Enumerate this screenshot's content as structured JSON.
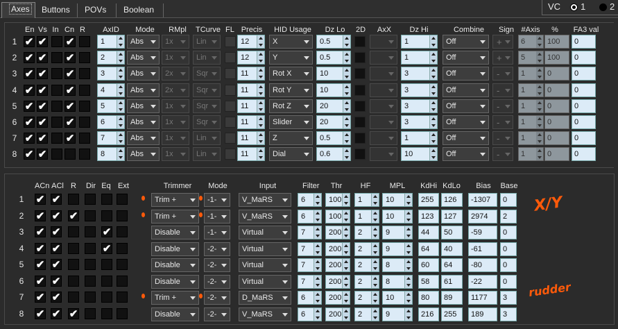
{
  "tabs": [
    {
      "label": "Axes",
      "active": true
    },
    {
      "label": "Buttons"
    },
    {
      "label": "POVs"
    },
    {
      "label": "Boolean"
    }
  ],
  "vc": {
    "label": "VC",
    "opt1": "1",
    "opt2": "2"
  },
  "axes_table": {
    "headers": {
      "en": "En",
      "vs": "Vs",
      "in": "In",
      "cn": "Cn",
      "r": "R",
      "axid": "AxID",
      "mode": "Mode",
      "rmpl": "RMpl",
      "tcurve": "TCurve",
      "fl": "FL",
      "precis": "Precis",
      "hid": "HID Usage",
      "dzlo": "Dz Lo",
      "twod": "2D",
      "axx": "AxX",
      "dzhi": "Dz Hi",
      "combine": "Combine",
      "sign": "Sign",
      "naxis": "#Axis",
      "pct": "%",
      "fa3": "FA3 val"
    },
    "rows": [
      {
        "num": "1",
        "en": true,
        "vs": true,
        "in": false,
        "cn": true,
        "r": false,
        "axid": "1",
        "mode": "Abs",
        "rmpl": "1x",
        "tcurve": "Lin",
        "precis": "12",
        "hid": "X",
        "dzlo": "0.5",
        "dzhi": "1",
        "combine": "Off",
        "sign": "+",
        "naxis": "6",
        "pct": "100",
        "fa3": "0"
      },
      {
        "num": "2",
        "en": true,
        "vs": true,
        "in": false,
        "cn": true,
        "r": false,
        "axid": "2",
        "mode": "Abs",
        "rmpl": "1x",
        "tcurve": "Lin",
        "precis": "12",
        "hid": "Y",
        "dzlo": "0.5",
        "dzhi": "1",
        "combine": "Off",
        "sign": "+",
        "naxis": "5",
        "pct": "100",
        "fa3": "0"
      },
      {
        "num": "3",
        "en": true,
        "vs": true,
        "in": false,
        "cn": true,
        "r": false,
        "axid": "3",
        "mode": "Abs",
        "rmpl": "2x",
        "tcurve": "Sqr",
        "precis": "11",
        "hid": "Rot X",
        "dzlo": "10",
        "dzhi": "3",
        "combine": "Off",
        "sign": "-",
        "naxis": "1",
        "pct": "0",
        "fa3": "0"
      },
      {
        "num": "4",
        "en": true,
        "vs": true,
        "in": false,
        "cn": true,
        "r": false,
        "axid": "4",
        "mode": "Abs",
        "rmpl": "2x",
        "tcurve": "Sqr",
        "precis": "11",
        "hid": "Rot Y",
        "dzlo": "10",
        "dzhi": "3",
        "combine": "Off",
        "sign": "-",
        "naxis": "1",
        "pct": "0",
        "fa3": "0"
      },
      {
        "num": "5",
        "en": true,
        "vs": true,
        "in": false,
        "cn": true,
        "r": false,
        "axid": "5",
        "mode": "Abs",
        "rmpl": "1x",
        "tcurve": "Sqr",
        "precis": "11",
        "hid": "Rot Z",
        "dzlo": "20",
        "dzhi": "3",
        "combine": "Off",
        "sign": "-",
        "naxis": "1",
        "pct": "0",
        "fa3": "0"
      },
      {
        "num": "6",
        "en": true,
        "vs": true,
        "in": false,
        "cn": true,
        "r": false,
        "axid": "6",
        "mode": "Abs",
        "rmpl": "1x",
        "tcurve": "Sqr",
        "precis": "11",
        "hid": "Slider",
        "dzlo": "20",
        "dzhi": "3",
        "combine": "Off",
        "sign": "-",
        "naxis": "1",
        "pct": "0",
        "fa3": "0"
      },
      {
        "num": "7",
        "en": true,
        "vs": true,
        "in": false,
        "cn": true,
        "r": false,
        "axid": "7",
        "mode": "Abs",
        "rmpl": "1x",
        "tcurve": "Lin",
        "precis": "11",
        "hid": "Z",
        "dzlo": "0.5",
        "dzhi": "1",
        "combine": "Off",
        "sign": "-",
        "naxis": "1",
        "pct": "0",
        "fa3": "0"
      },
      {
        "num": "8",
        "en": true,
        "vs": true,
        "in": false,
        "cn": false,
        "r": false,
        "axid": "8",
        "mode": "Abs",
        "rmpl": "1x",
        "tcurve": "Lin",
        "precis": "11",
        "hid": "Dial",
        "dzlo": "0.6",
        "dzhi": "10",
        "combine": "Off",
        "sign": "-",
        "naxis": "1",
        "pct": "0",
        "fa3": "0"
      }
    ]
  },
  "filter_table": {
    "headers": {
      "acn": "ACn",
      "acl": "ACl",
      "r": "R",
      "dir": "Dir",
      "eq": "Eq",
      "ext": "Ext",
      "trimmer": "Trimmer",
      "mode": "Mode",
      "input": "Input",
      "filter": "Filter",
      "thr": "Thr",
      "hf": "HF",
      "mpl": "MPL",
      "kdhi": "KdHi",
      "kdlo": "KdLo",
      "bias": "Bias",
      "base": "Base"
    },
    "rows": [
      {
        "num": "1",
        "acn": true,
        "acl": true,
        "r": false,
        "dir": false,
        "eq": false,
        "ext": false,
        "trimmer": "Trim +",
        "mode": "-1-",
        "input": "V_MaRS",
        "filter": "6",
        "thr": "100",
        "hf": "1",
        "mpl": "10",
        "kdhi": "255",
        "kdlo": "126",
        "bias": "-1307",
        "base": "0",
        "mark": true
      },
      {
        "num": "2",
        "acn": true,
        "acl": true,
        "r": true,
        "dir": false,
        "eq": false,
        "ext": false,
        "trimmer": "Trim +",
        "mode": "-1-",
        "input": "V_MaRS",
        "filter": "6",
        "thr": "100",
        "hf": "1",
        "mpl": "10",
        "kdhi": "123",
        "kdlo": "127",
        "bias": "2974",
        "base": "2",
        "mark": true
      },
      {
        "num": "3",
        "acn": true,
        "acl": true,
        "r": false,
        "dir": false,
        "eq": true,
        "ext": false,
        "trimmer": "Disable",
        "mode": "-1-",
        "input": "Virtual",
        "filter": "7",
        "thr": "200",
        "hf": "2",
        "mpl": "9",
        "kdhi": "44",
        "kdlo": "50",
        "bias": "-59",
        "base": "0"
      },
      {
        "num": "4",
        "acn": true,
        "acl": true,
        "r": false,
        "dir": false,
        "eq": true,
        "ext": false,
        "trimmer": "Disable",
        "mode": "-2-",
        "input": "Virtual",
        "filter": "7",
        "thr": "200",
        "hf": "2",
        "mpl": "9",
        "kdhi": "64",
        "kdlo": "40",
        "bias": "-61",
        "base": "0"
      },
      {
        "num": "5",
        "acn": true,
        "acl": true,
        "r": false,
        "dir": false,
        "eq": false,
        "ext": false,
        "trimmer": "Disable",
        "mode": "-2-",
        "input": "Virtual",
        "filter": "7",
        "thr": "200",
        "hf": "2",
        "mpl": "8",
        "kdhi": "60",
        "kdlo": "64",
        "bias": "-80",
        "base": "0"
      },
      {
        "num": "6",
        "acn": true,
        "acl": true,
        "r": false,
        "dir": false,
        "eq": false,
        "ext": false,
        "trimmer": "Disable",
        "mode": "-2-",
        "input": "Virtual",
        "filter": "7",
        "thr": "200",
        "hf": "2",
        "mpl": "8",
        "kdhi": "58",
        "kdlo": "61",
        "bias": "-22",
        "base": "0"
      },
      {
        "num": "7",
        "acn": true,
        "acl": true,
        "r": false,
        "dir": false,
        "eq": false,
        "ext": false,
        "trimmer": "Trim +",
        "mode": "-2-",
        "input": "D_MaRS",
        "filter": "6",
        "thr": "200",
        "hf": "2",
        "mpl": "10",
        "kdhi": "80",
        "kdlo": "89",
        "bias": "1177",
        "base": "3",
        "mark": true
      },
      {
        "num": "8",
        "acn": true,
        "acl": true,
        "r": true,
        "dir": false,
        "eq": false,
        "ext": false,
        "trimmer": "Disable",
        "mode": "-2-",
        "input": "V_MaRS",
        "filter": "6",
        "thr": "200",
        "hf": "2",
        "mpl": "9",
        "kdhi": "216",
        "kdlo": "255",
        "bias": "189",
        "base": "3"
      }
    ]
  },
  "annotations": {
    "xy": "X/Y",
    "rudder": "rudder"
  },
  "colors": {
    "accent": "#ff5a0a",
    "field": "#dcebf7"
  }
}
